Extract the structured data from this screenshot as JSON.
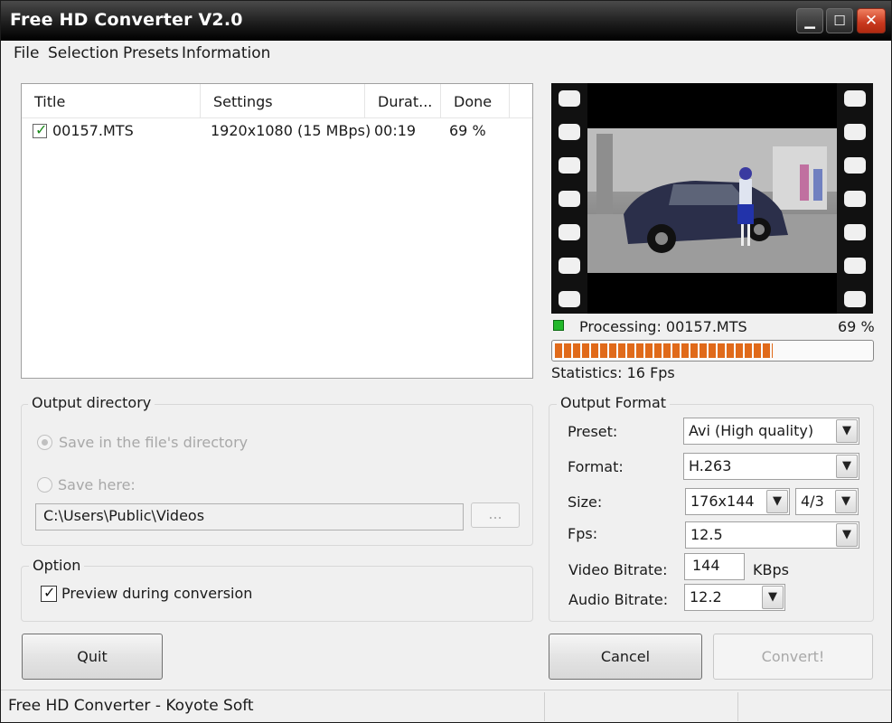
{
  "window": {
    "title": "Free HD Converter V2.0"
  },
  "titlebar_buttons": {
    "minimize": "▁",
    "maximize": "☐",
    "close": "✕"
  },
  "menu": {
    "file": "File",
    "selection": "Selection",
    "presets": "Presets",
    "information": "Information"
  },
  "table": {
    "columns": [
      "Title",
      "Settings",
      "Durat...",
      "Done"
    ],
    "rows": [
      {
        "checked": true,
        "title": "00157.MTS",
        "settings": "1920x1080 (15 MBps)",
        "duration": "00:19",
        "done": "69 %"
      }
    ]
  },
  "processing": {
    "label": "Processing: 00157.MTS",
    "percent_text": "69 %",
    "progress": 0.69,
    "statistics": "Statistics: 16 Fps",
    "led_color": "#22b82a",
    "bar_color": "#e06a1a"
  },
  "output_directory": {
    "title": "Output directory",
    "option_file_dir": "Save in the file's directory",
    "option_save_here": "Save here:",
    "path": "C:\\Users\\Public\\Videos",
    "browse_label": "..."
  },
  "option": {
    "title": "Option",
    "preview_label": "Preview during conversion",
    "preview_checked": true
  },
  "output_format": {
    "title": "Output Format",
    "preset_label": "Preset:",
    "preset_value": "Avi (High quality)",
    "format_label": "Format:",
    "format_value": "H.263",
    "size_label": "Size:",
    "size_value": "176x144",
    "ratio_value": "4/3",
    "fps_label": "Fps:",
    "fps_value": "12.5",
    "video_bitrate_label": "Video Bitrate:",
    "video_bitrate_value": "144",
    "video_bitrate_unit": "KBps",
    "audio_bitrate_label": "Audio Bitrate:",
    "audio_bitrate_value": "12.2"
  },
  "buttons": {
    "quit": "Quit",
    "cancel": "Cancel",
    "convert": "Convert!"
  },
  "statusbar": {
    "text": "Free HD Converter - Koyote Soft"
  },
  "icons": {
    "dropdown": "chevron-down-icon",
    "check": "check-icon"
  }
}
